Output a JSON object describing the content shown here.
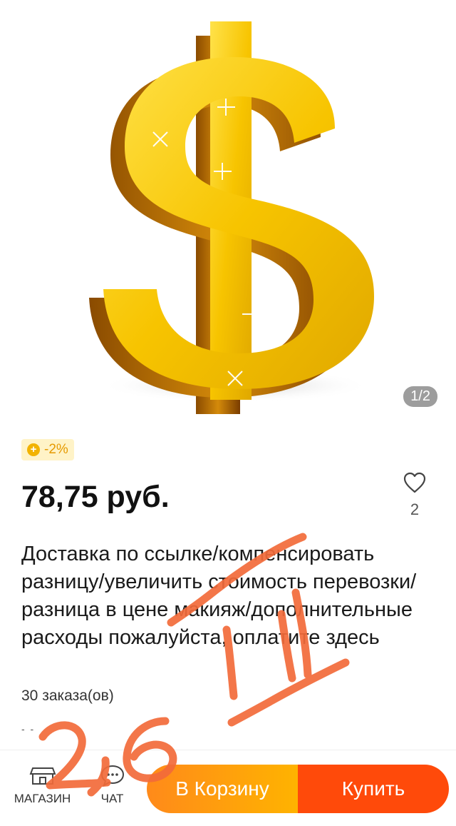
{
  "gallery": {
    "pager": "1/2"
  },
  "product": {
    "discount": "-2%",
    "price": "78,75 руб.",
    "wishlist_count": "2",
    "title": "Доставка по ссылке/компенсировать разницу/увеличить стоимость перевозки/разница в цене макияж/дополнительные расходы пожалуйста, оплатите здесь",
    "orders": "30 заказа(ов)",
    "more": "- -"
  },
  "bottom_bar": {
    "shop_label": "МАГАЗИН",
    "chat_label": "ЧАТ",
    "cart_label": "В Корзину",
    "buy_label": "Купить"
  },
  "colors": {
    "accent_orange": "#ff8a1a",
    "buy_red": "#ff4a0a",
    "discount_bg": "#fff3c7",
    "scribble": "#f26b3a"
  },
  "icons": [
    "dollar-sign-image",
    "coin-icon",
    "heart-icon",
    "shop-icon",
    "chat-icon"
  ]
}
